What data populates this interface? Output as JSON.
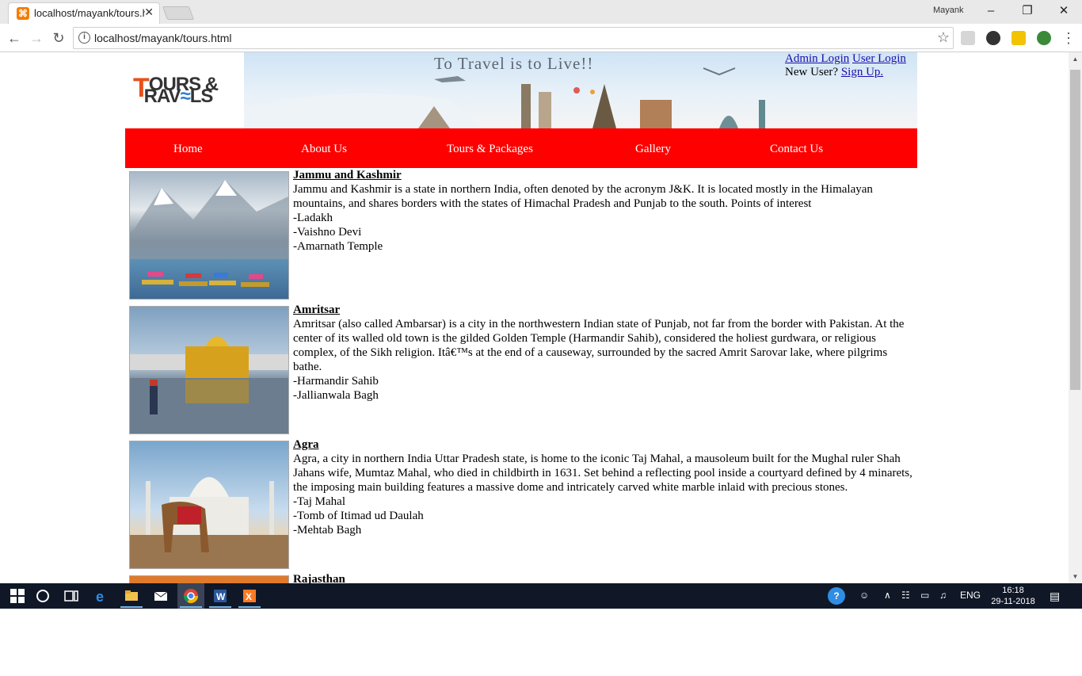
{
  "browser": {
    "tab_title": "localhost/mayank/tours.h",
    "profile_name": "Mayank",
    "url": "localhost/mayank/tours.html"
  },
  "site": {
    "logo_line1": "OURS &",
    "logo_line2": "RAV",
    "logo_line2b": "LS",
    "banner_text": "To Travel is to Live!!",
    "auth": {
      "admin_login": "Admin Login",
      "user_login": "User Login",
      "new_user": "New User?",
      "sign_up": "Sign Up."
    },
    "nav": [
      "Home",
      "About Us",
      "Tours & Packages",
      "Gallery",
      "Contact Us"
    ],
    "accent_color": "#ff0000",
    "destinations": [
      {
        "title": "Jammu and Kashmir",
        "description": "Jammu and Kashmir is a state in northern India, often denoted by the acronym J&K. It is located mostly in the Himalayan mountains, and shares borders with the states of Himachal Pradesh and Punjab to the south. Points of interest",
        "points": [
          "-Ladakh",
          "-Vaishno Devi",
          "-Amarnath Temple"
        ]
      },
      {
        "title": "Amritsar",
        "description": "Amritsar (also called Ambarsar) is a city in the northwestern Indian state of Punjab, not far from the border with Pakistan. At the center of its walled old town is the gilded Golden Temple (Harmandir Sahib), considered the holiest gurdwara, or religious complex, of the Sikh religion. Itâ€™s at the end of a causeway, surrounded by the sacred Amrit Sarovar lake, where pilgrims bathe.",
        "points": [
          "-Harmandir Sahib",
          "-Jallianwala Bagh"
        ]
      },
      {
        "title": "Agra",
        "description": "Agra, a city in northern India Uttar Pradesh state, is home to the iconic Taj Mahal, a mausoleum built for the Mughal ruler Shah Jahans wife, Mumtaz Mahal, who died in childbirth in 1631. Set behind a reflecting pool inside a courtyard defined by 4 minarets, the imposing main building features a massive dome and intricately carved white marble inlaid with precious stones.",
        "points": [
          "-Taj Mahal",
          "-Tomb of Itimad ud Daulah",
          "-Mehtab Bagh"
        ]
      },
      {
        "title": "Rajasthan",
        "description": "",
        "points": []
      }
    ]
  },
  "taskbar": {
    "language": "ENG",
    "time": "16:18",
    "date": "29-11-2018"
  }
}
